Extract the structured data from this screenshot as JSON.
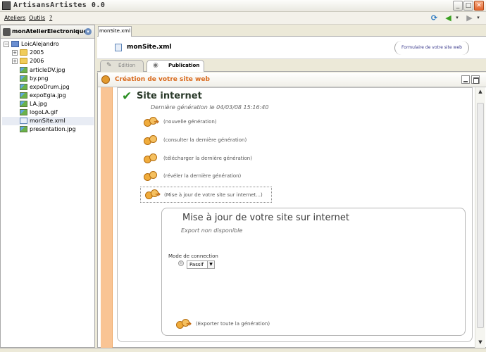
{
  "window": {
    "title": "ArtisansArtistes 0.0"
  },
  "menu": {
    "items": [
      "Ateliers",
      "Outils",
      "?"
    ]
  },
  "project": {
    "title": "monAtelierElectronique"
  },
  "tree": [
    {
      "label": "LoicAlejandro",
      "type": "root",
      "expander": "-"
    },
    {
      "label": "2005",
      "type": "folder",
      "expander": "+"
    },
    {
      "label": "2006",
      "type": "folder",
      "expander": "+"
    },
    {
      "label": "articleDV.jpg",
      "type": "img"
    },
    {
      "label": "by.png",
      "type": "img"
    },
    {
      "label": "expoDrum.jpg",
      "type": "img"
    },
    {
      "label": "expoEgia.jpg",
      "type": "img"
    },
    {
      "label": "LA.jpg",
      "type": "img"
    },
    {
      "label": "logoLA.gif",
      "type": "img"
    },
    {
      "label": "monSite.xml",
      "type": "xml",
      "selected": true
    },
    {
      "label": "presentation.jpg",
      "type": "img"
    }
  ],
  "editor": {
    "tab_label": "monSite.xml",
    "file_title": "monSite.xml",
    "form_link": "Formulaire de votre site web",
    "subtabs": {
      "edition": "Édition",
      "publication": "Publication"
    }
  },
  "section": {
    "title": "Création de votre site web"
  },
  "site": {
    "title": "Site internet",
    "last_generation": "Dernière génération le 04/03/08 15:16:40"
  },
  "actions": [
    "(nouvelle génération)",
    "(consulter la dernière génération)",
    "(télécharger la dernière génération)",
    "(révéler la dernière génération)",
    "(Mise à jour de votre site sur internet...)"
  ],
  "update": {
    "title": "Mise à jour de votre site sur internet",
    "note": "Export non disponible",
    "mode_label": "Mode de connection",
    "mode_value": "Passif",
    "export_label": "(Exporter toute la génération)"
  }
}
